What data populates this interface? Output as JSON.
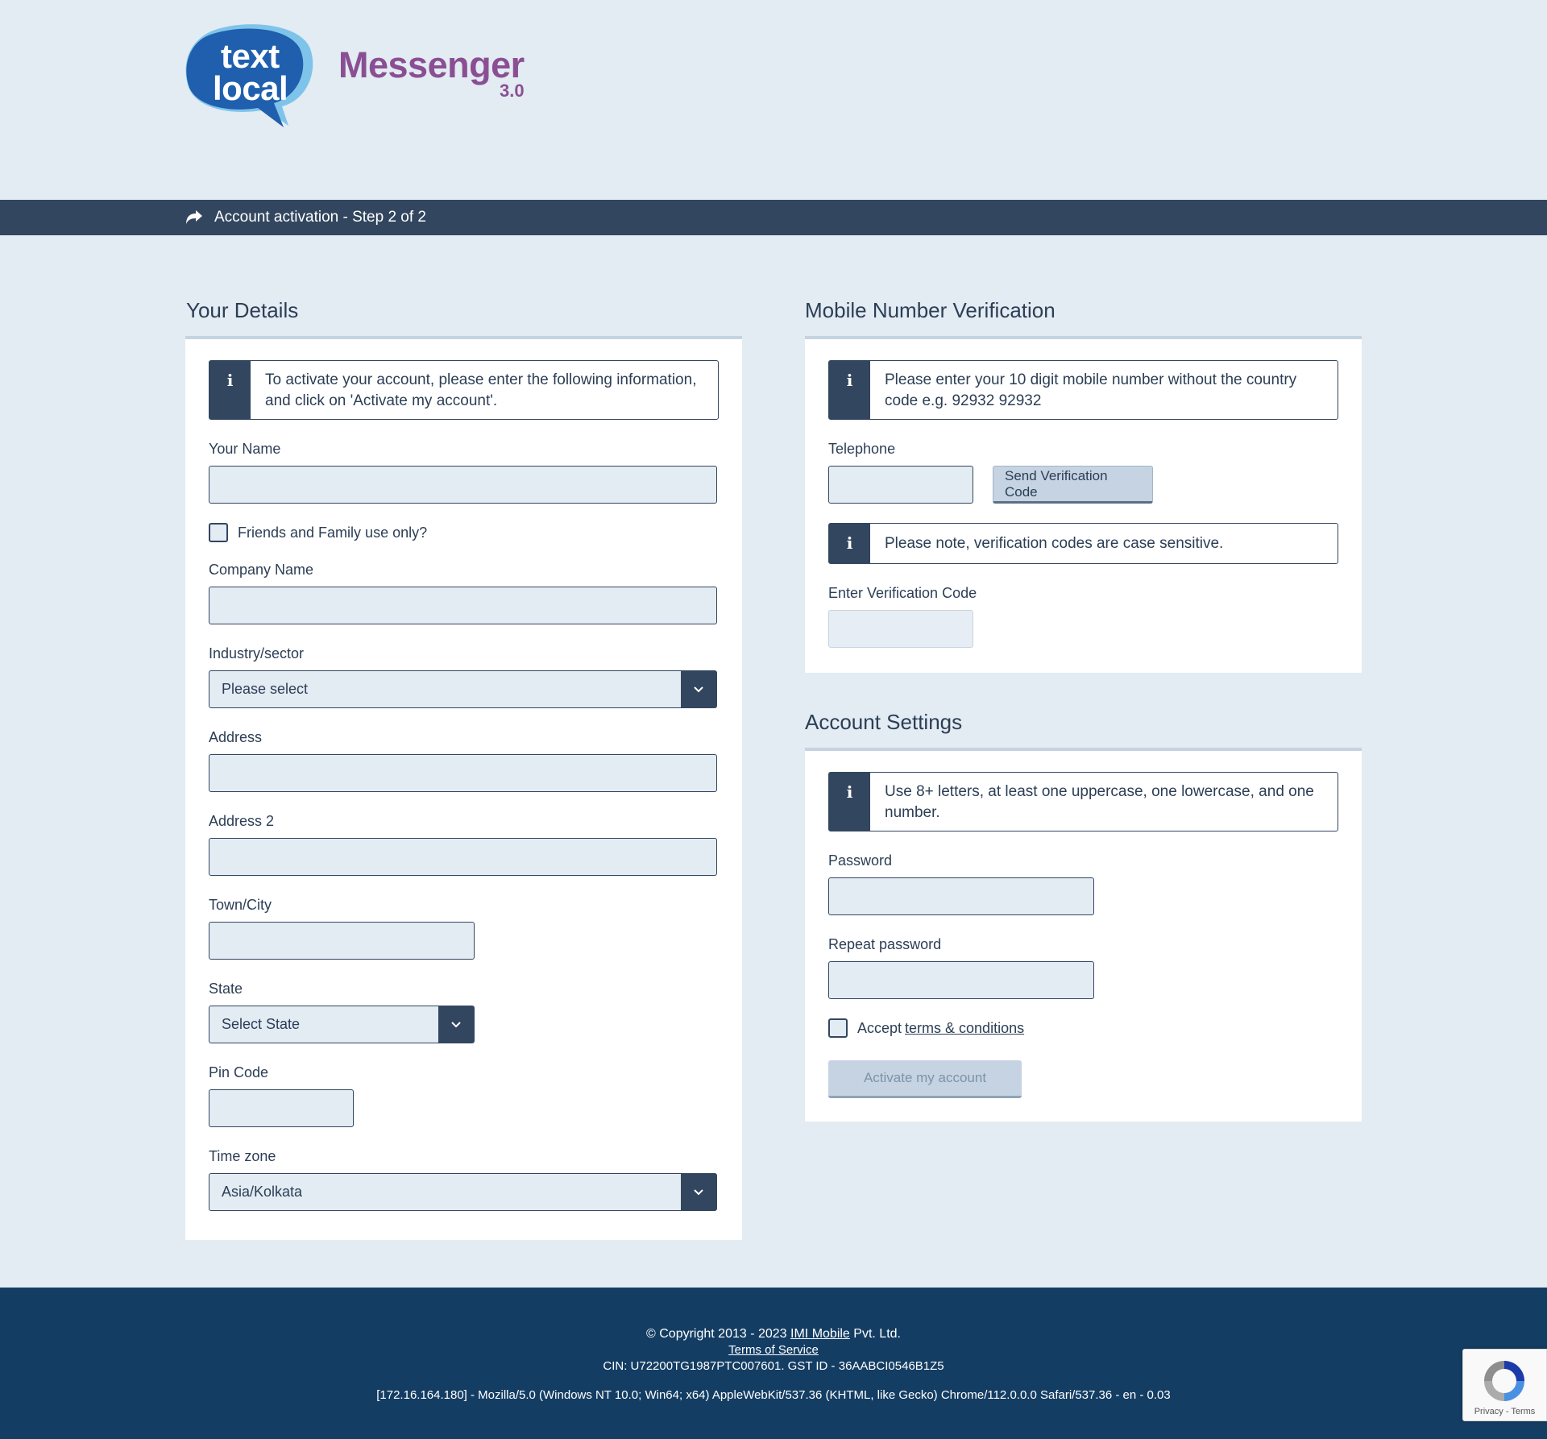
{
  "header": {
    "logo_line1": "text",
    "logo_line2": "local",
    "product_name": "Messenger",
    "product_version": "3.0"
  },
  "stepbar": {
    "title": "Account activation - Step 2 of 2"
  },
  "your_details": {
    "title": "Your Details",
    "info": "To activate your account, please enter the following information, and click on 'Activate my account'.",
    "name_label": "Your Name",
    "friends_label": "Friends and Family use only?",
    "company_label": "Company Name",
    "industry_label": "Industry/sector",
    "industry_value": "Please select",
    "address_label": "Address",
    "address2_label": "Address 2",
    "town_label": "Town/City",
    "state_label": "State",
    "state_value": "Select State",
    "pin_label": "Pin Code",
    "timezone_label": "Time zone",
    "timezone_value": "Asia/Kolkata"
  },
  "mobile": {
    "title": "Mobile Number Verification",
    "info": "Please enter your 10 digit mobile number without the country code e.g. 92932 92932",
    "telephone_label": "Telephone",
    "send_button": "Send Verification Code",
    "note": "Please note, verification codes are case sensitive.",
    "code_label": "Enter Verification Code"
  },
  "account": {
    "title": "Account Settings",
    "info": "Use 8+ letters, at least one uppercase, one lowercase, and one number.",
    "password_label": "Password",
    "repeat_label": "Repeat password",
    "accept_text": "Accept",
    "terms_link": "terms & conditions",
    "activate_button": "Activate my account"
  },
  "footer": {
    "copyright_prefix": "© Copyright 2013 - 2023",
    "company_link": "IMI Mobile",
    "copyright_suffix": "Pvt. Ltd.",
    "terms": "Terms of Service",
    "cin": "CIN: U72200TG1987PTC007601. GST ID - 36AABCI0546B1Z5",
    "agent": "[172.16.164.180] - Mozilla/5.0 (Windows NT 10.0; Win64; x64) AppleWebKit/537.36 (KHTML, like Gecko) Chrome/112.0.0.0 Safari/537.36 - en - 0.03"
  },
  "recaptcha": {
    "text": "Privacy - Terms"
  },
  "colors": {
    "page_bg": "#e3ebf3",
    "navy": "#33465f",
    "footer_bg": "#143d63",
    "brand_purple": "#8a4f93",
    "logo_blue": "#1f5fae"
  }
}
